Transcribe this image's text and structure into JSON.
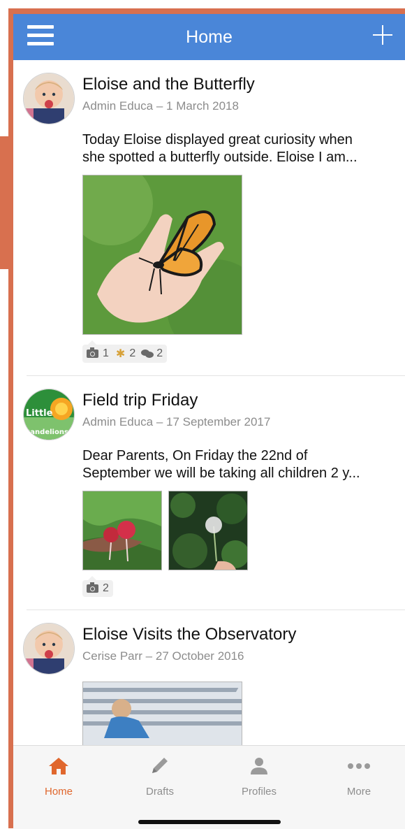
{
  "header": {
    "title": "Home",
    "menu_icon": "hamburger-icon",
    "add_icon": "plus-icon"
  },
  "posts": [
    {
      "title": "Eloise and the Butterfly",
      "meta": "Admin Educa – 1 March 2018",
      "text_line1": "Today Eloise displayed great curiosity when",
      "text_line2": "she spotted a butterfly outside. Eloise I am...",
      "stats": {
        "photos": "1",
        "awards": "2",
        "comments": "2"
      }
    },
    {
      "title": "Field trip Friday",
      "meta": "Admin Educa – 17 September 2017",
      "avatar_logo_line1": "Little",
      "avatar_logo_line2": "Dandelions",
      "text_line1": "Dear Parents, On Friday the 22nd of",
      "text_line2": "September we will be taking all children 2 y...",
      "stats": {
        "photos": "2"
      }
    },
    {
      "title": "Eloise Visits the Observatory",
      "meta": "Cerise Parr – 27 October 2016"
    }
  ],
  "tabbar": {
    "tabs": [
      {
        "label": "Home",
        "icon": "home-icon",
        "active": true
      },
      {
        "label": "Drafts",
        "icon": "pencil-icon"
      },
      {
        "label": "Profiles",
        "icon": "person-icon"
      },
      {
        "label": "More",
        "icon": "more-dots-icon"
      }
    ],
    "active_color": "#e0672d",
    "inactive_color": "#8e8e8e"
  },
  "colors": {
    "header": "#4a86d8",
    "frame": "#d8704f"
  }
}
